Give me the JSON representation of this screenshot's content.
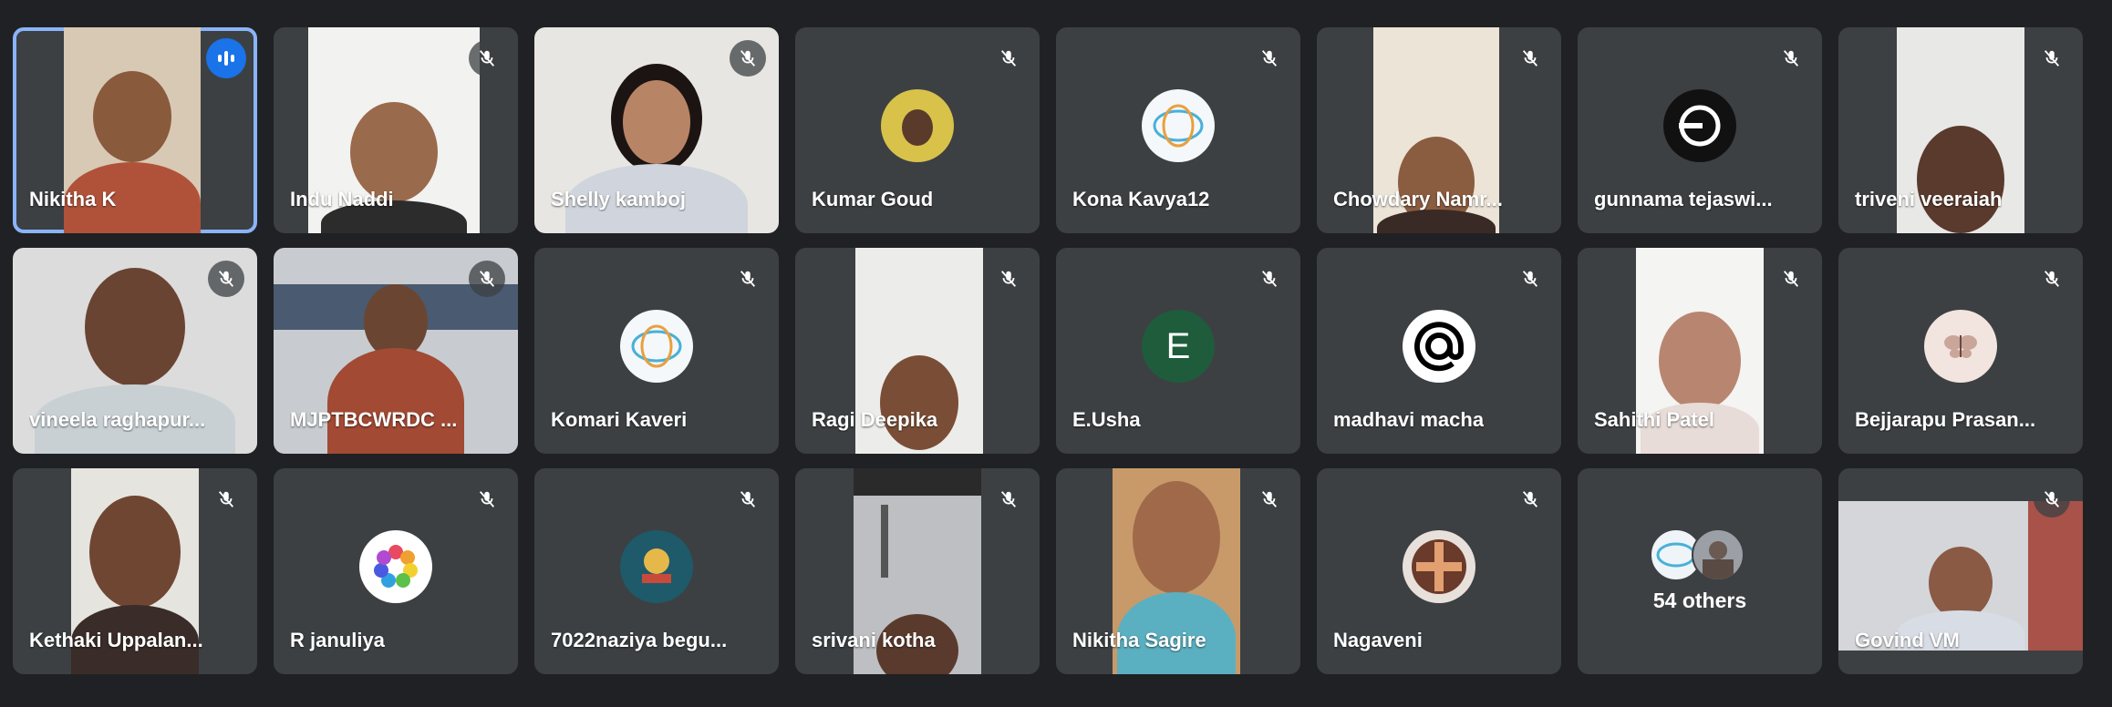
{
  "meeting": {
    "participants": [
      {
        "name": "Nikitha K",
        "muted": false,
        "speaking": true,
        "tile": "video"
      },
      {
        "name": "Indu Naddi",
        "muted": true,
        "tile": "video"
      },
      {
        "name": "Shelly kamboj",
        "muted": true,
        "tile": "video"
      },
      {
        "name": "Kumar Goud",
        "muted": true,
        "tile": "avatar",
        "avatar_icon": "photo-avatar"
      },
      {
        "name": "Kona Kavya12",
        "muted": true,
        "tile": "avatar",
        "avatar_icon": "logo-avatar"
      },
      {
        "name": "Chowdary Namr...",
        "muted": true,
        "tile": "video"
      },
      {
        "name": "gunnama tejaswi...",
        "muted": true,
        "tile": "avatar",
        "avatar_icon": "logo-avatar"
      },
      {
        "name": "triveni veeraiah",
        "muted": true,
        "tile": "video"
      },
      {
        "name": "vineela raghapur...",
        "muted": true,
        "tile": "video"
      },
      {
        "name": "MJPTBCWRDC ...",
        "muted": true,
        "tile": "video"
      },
      {
        "name": "Komari Kaveri",
        "muted": true,
        "tile": "avatar",
        "avatar_icon": "logo-avatar"
      },
      {
        "name": "Ragi Deepika",
        "muted": true,
        "tile": "video"
      },
      {
        "name": "E.Usha",
        "muted": true,
        "tile": "letter",
        "avatar_letter": "E"
      },
      {
        "name": "madhavi macha",
        "muted": true,
        "tile": "avatar",
        "avatar_icon": "at-sign-avatar"
      },
      {
        "name": "Sahithi Patel",
        "muted": true,
        "tile": "video"
      },
      {
        "name": "Bejjarapu Prasan...",
        "muted": true,
        "tile": "avatar",
        "avatar_icon": "butterfly-avatar"
      },
      {
        "name": "Kethaki Uppalan...",
        "muted": true,
        "tile": "video"
      },
      {
        "name": "R januliya",
        "muted": true,
        "tile": "avatar",
        "avatar_icon": "flower-avatar"
      },
      {
        "name": "7022naziya begu...",
        "muted": true,
        "tile": "avatar",
        "avatar_icon": "skills-logo-avatar"
      },
      {
        "name": "srivani kotha",
        "muted": true,
        "tile": "video"
      },
      {
        "name": "Nikitha Sagire",
        "muted": true,
        "tile": "video"
      },
      {
        "name": "Nagaveni",
        "muted": true,
        "tile": "avatar",
        "avatar_icon": "photo-avatar"
      },
      {
        "name": "",
        "tile": "others",
        "others_label": "54 others"
      },
      {
        "name": "Govind VM",
        "muted": true,
        "tile": "video"
      }
    ]
  },
  "colors": {
    "background": "#202124",
    "tile": "#3c4043",
    "speaking_border": "#8ab4f8",
    "speaking_badge": "#1a73e8",
    "letter_avatar": "#1e5c3c"
  }
}
